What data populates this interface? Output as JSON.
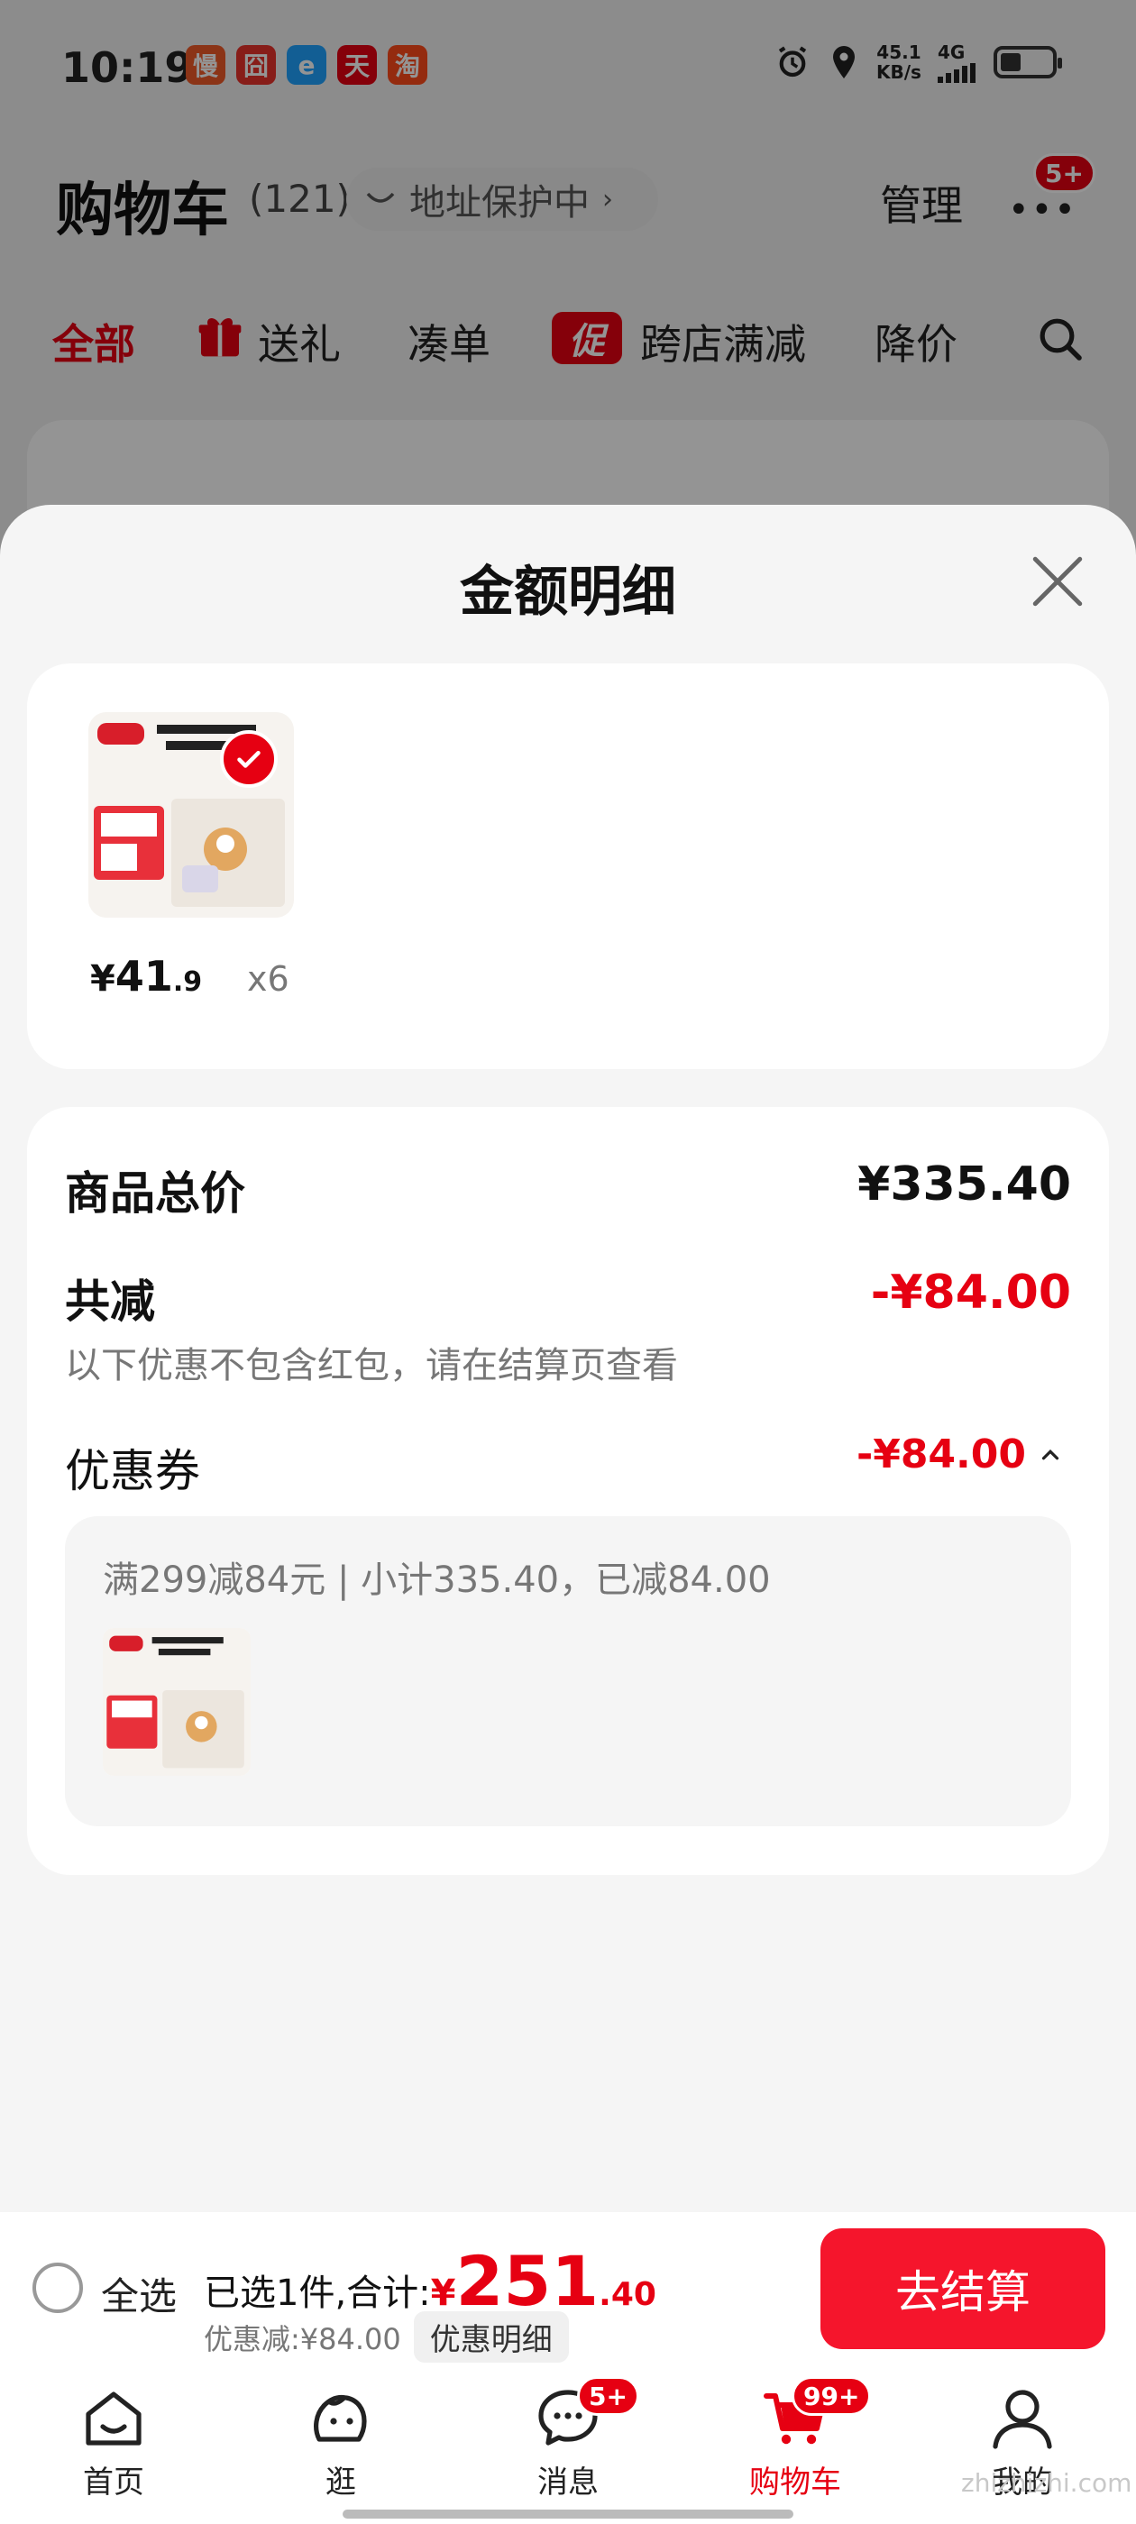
{
  "status_bar": {
    "time": "10:19",
    "apps": [
      {
        "glyph": "慢",
        "color": "#f05a28"
      },
      {
        "glyph": "囧",
        "color": "#e8322b"
      },
      {
        "glyph": "e",
        "color": "#1fa2ff"
      },
      {
        "glyph": "天",
        "color": "#e60012"
      },
      {
        "glyph": "淘",
        "color": "#ff4a1a"
      }
    ],
    "net_speed_value": "45.1",
    "net_speed_unit": "KB/s",
    "network": "4G"
  },
  "cart_header": {
    "title": "购物车",
    "count": "(121)",
    "address_label": "地址保护中",
    "manage_label": "管理",
    "more_badge": "5+"
  },
  "filters": [
    "全部",
    "送礼",
    "凑单",
    "跨店满减",
    "降价"
  ],
  "promo_chip": "促",
  "sheet": {
    "title": "金额明细",
    "product": {
      "price_yen": "¥",
      "price_int": "41",
      "price_dec": ".9",
      "quantity": "x6"
    },
    "rows": {
      "total_label": "商品总价",
      "total_value": "¥335.40",
      "reduce_label": "共减",
      "reduce_value": "-¥84.00",
      "note": "以下优惠不包含红包，请在结算页查看",
      "coupon_label": "优惠券",
      "coupon_value": "-¥84.00"
    },
    "coupon_detail": "满299减84元 | 小计335.40，已减84.00"
  },
  "checkout": {
    "select_all": "全选",
    "summary": "已选1件,合计:",
    "total_yen": "¥",
    "total_int": "251",
    "total_dec": ".40",
    "discount": "优惠减:¥84.00",
    "detail_chip": "优惠明细",
    "button": "去结算"
  },
  "tabs": [
    {
      "label": "首页",
      "icon": "home-icon"
    },
    {
      "label": "逛",
      "icon": "browse-icon"
    },
    {
      "label": "消息",
      "icon": "message-icon",
      "badge": "5+"
    },
    {
      "label": "购物车",
      "icon": "cart-icon",
      "badge": "99+",
      "active": true
    },
    {
      "label": "我的",
      "icon": "profile-icon"
    }
  ],
  "watermark": "zhizhizhi.com",
  "colors": {
    "accent": "#e60012",
    "button": "#f5152c"
  }
}
